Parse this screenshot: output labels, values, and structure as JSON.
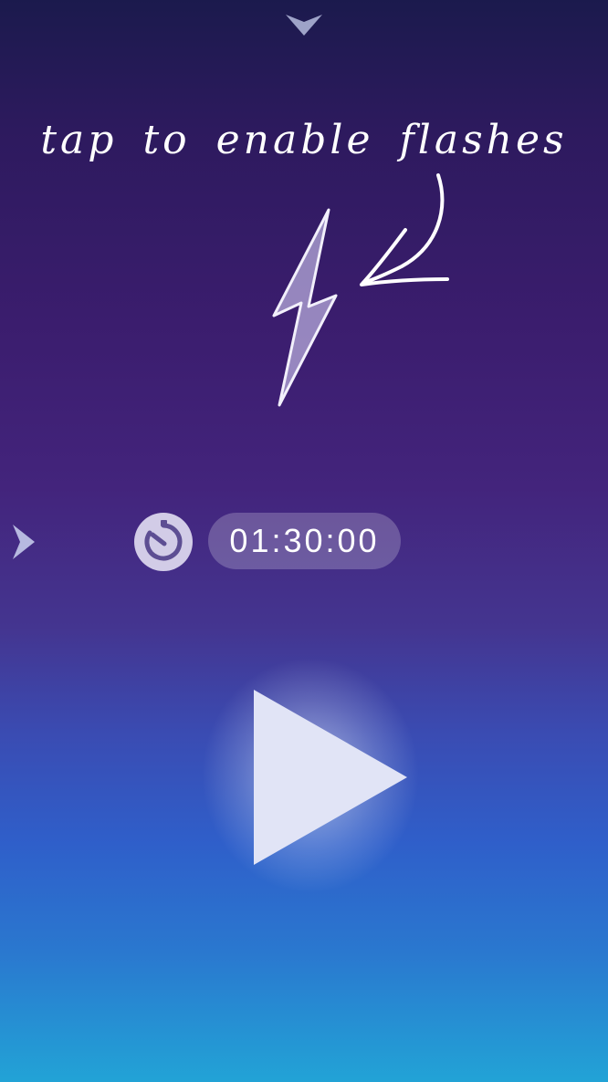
{
  "hint": {
    "text": "tap to enable flashes"
  },
  "timer": {
    "value": "01:30:00"
  },
  "icons": {
    "top": "chevron-down-icon",
    "side": "chevron-right-icon",
    "flash": "lightning-bolt-icon",
    "timer": "timer-icon",
    "play": "play-icon",
    "hint_arrow": "curved-arrow-icon"
  },
  "colors": {
    "top_background": "#1b1a4d",
    "middle_background": "#43247c",
    "bottom_background": "#22a3d6",
    "text": "#ffffff"
  }
}
